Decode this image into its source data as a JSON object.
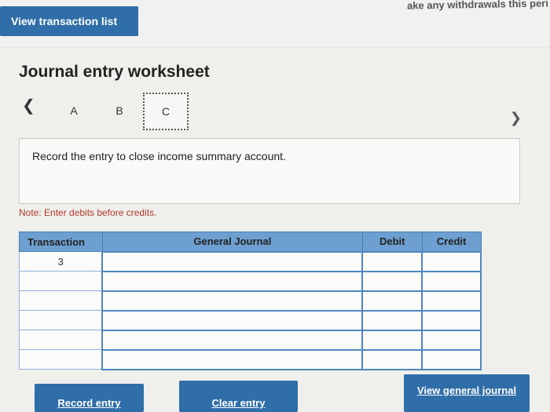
{
  "header": {
    "partial_text": "ake any withdrawals this peri",
    "view_transaction_list": "View transaction list"
  },
  "worksheet": {
    "title": "Journal entry worksheet",
    "tabs": [
      "A",
      "B",
      "C"
    ],
    "active_tab": "C",
    "instruction": "Record the entry to close income summary account.",
    "note": "Note: Enter debits before credits."
  },
  "table": {
    "headers": {
      "transaction": "Transaction",
      "general_journal": "General Journal",
      "debit": "Debit",
      "credit": "Credit"
    },
    "rows": [
      {
        "transaction": "3",
        "account": "",
        "debit": "",
        "credit": ""
      },
      {
        "transaction": "",
        "account": "",
        "debit": "",
        "credit": ""
      },
      {
        "transaction": "",
        "account": "",
        "debit": "",
        "credit": ""
      },
      {
        "transaction": "",
        "account": "",
        "debit": "",
        "credit": ""
      },
      {
        "transaction": "",
        "account": "",
        "debit": "",
        "credit": ""
      },
      {
        "transaction": "",
        "account": "",
        "debit": "",
        "credit": ""
      }
    ]
  },
  "buttons": {
    "record_entry": "Record entry",
    "clear_entry": "Clear entry",
    "view_general_journal": "View general journal"
  },
  "colors": {
    "accent": "#2f6ea8",
    "table_header": "#6d9fd0",
    "note_text": "#b23a2b"
  }
}
